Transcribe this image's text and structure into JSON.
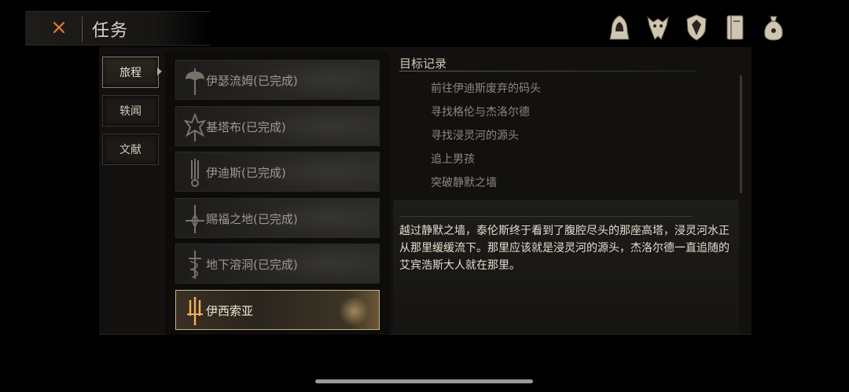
{
  "header": {
    "title": "任务"
  },
  "top_icons": [
    {
      "name": "hooded-figure-icon"
    },
    {
      "name": "beast-skull-icon"
    },
    {
      "name": "shield-emblem-icon"
    },
    {
      "name": "journal-book-icon"
    },
    {
      "name": "coin-pouch-icon"
    }
  ],
  "side_tabs": [
    {
      "label": "旅程",
      "active": true
    },
    {
      "label": "轶闻",
      "active": false
    },
    {
      "label": "文献",
      "active": false
    }
  ],
  "quests": [
    {
      "label": "伊瑟流姆(已完成)",
      "icon": "axe-emblem-icon"
    },
    {
      "label": "基塔布(已完成)",
      "icon": "tribal-sigil-icon"
    },
    {
      "label": "伊迪斯(已完成)",
      "icon": "trident-emblem-icon"
    },
    {
      "label": "赐福之地(已完成)",
      "icon": "sword-cross-icon"
    },
    {
      "label": "地下溶洞(已完成)",
      "icon": "serpent-sword-icon"
    },
    {
      "label": "伊西索亚",
      "icon": "trident-glow-icon",
      "active": true
    }
  ],
  "objectives": {
    "title": "目标记录",
    "items": [
      "前往伊迪斯废弃的码头",
      "寻找格伦与杰洛尔德",
      "寻找浸灵河的源头",
      "追上男孩",
      "突破静默之墙"
    ]
  },
  "description": "越过静默之墙，泰伦斯终于看到了腹腔尽头的那座高塔，浸灵河水正从那里缓缓流下。那里应该就是浸灵河的源头，杰洛尔德一直追随的艾宾浩斯大人就在那里。",
  "colors": {
    "accent": "#c9b483",
    "close_icon": "#e07a3a",
    "panel": "#121110"
  }
}
